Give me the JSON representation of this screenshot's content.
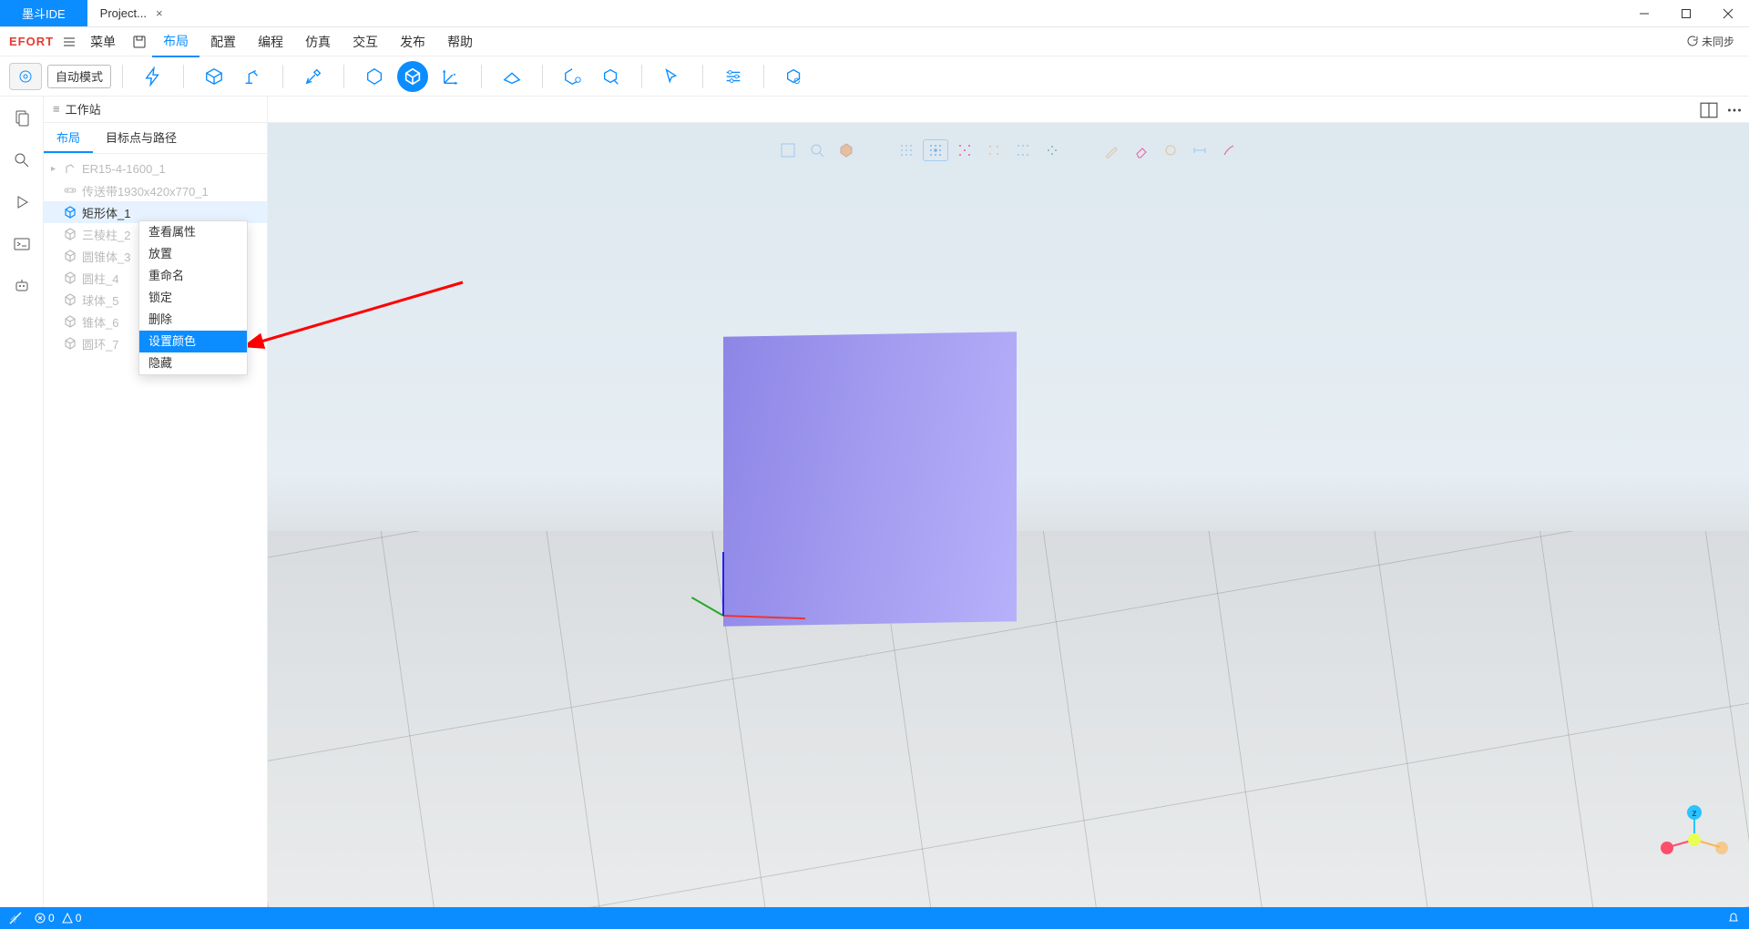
{
  "titlebar": {
    "app_name": "墨斗IDE",
    "file_tab": "Project...",
    "close_glyph": "×"
  },
  "menubar": {
    "brand": "EFORT",
    "menu_label": "菜单",
    "items": [
      "布局",
      "配置",
      "编程",
      "仿真",
      "交互",
      "发布",
      "帮助"
    ],
    "active_index": 0,
    "sync_label": "未同步"
  },
  "toolbar": {
    "mode_label": "自动模式"
  },
  "activitybar": {
    "items": [
      "files-icon",
      "search-icon",
      "run-icon",
      "terminal-icon",
      "robot-icon"
    ]
  },
  "sidepanel": {
    "title": "工作站",
    "tabs": [
      "布局",
      "目标点与路径"
    ],
    "active_tab": 0,
    "tree": [
      {
        "label": "ER15-4-1600_1",
        "icon": "robot",
        "enabled": false,
        "has_children": true
      },
      {
        "label": "传送带1930x420x770_1",
        "icon": "conveyor",
        "enabled": false
      },
      {
        "label": "矩形体_1",
        "icon": "cube",
        "enabled": true,
        "selected": true
      },
      {
        "label": "三棱柱_2",
        "icon": "cube",
        "enabled": false
      },
      {
        "label": "圆锥体_3",
        "icon": "cube",
        "enabled": false
      },
      {
        "label": "圆柱_4",
        "icon": "cube",
        "enabled": false
      },
      {
        "label": "球体_5",
        "icon": "cube",
        "enabled": false
      },
      {
        "label": "锥体_6",
        "icon": "cube",
        "enabled": false
      },
      {
        "label": "圆环_7",
        "icon": "cube",
        "enabled": false
      }
    ]
  },
  "context_menu": {
    "items": [
      "查看属性",
      "放置",
      "重命名",
      "锁定",
      "删除",
      "设置颜色",
      "隐藏"
    ],
    "highlight_index": 5
  },
  "statusbar": {
    "errors": "0",
    "warnings": "0"
  },
  "gizmo": {
    "axis_label": "z"
  }
}
